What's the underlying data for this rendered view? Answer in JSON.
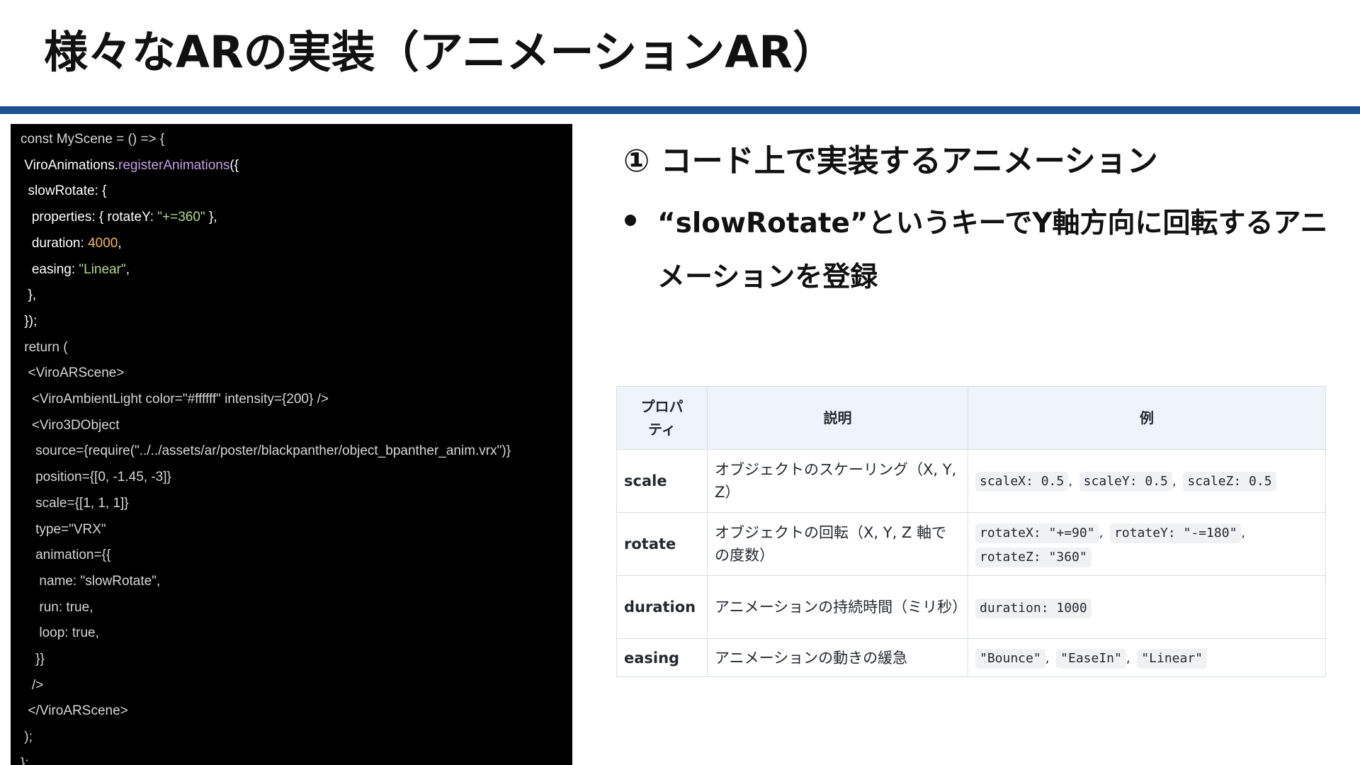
{
  "slide": {
    "title": "様々なARの実装（アニメーションAR）"
  },
  "code": {
    "lines": [
      [
        {
          "t": "const MyScene = () => {",
          "c": "plain"
        }
      ],
      [
        {
          "t": " ViroAnimations.",
          "c": "ident"
        },
        {
          "t": "registerAnimations",
          "c": "func"
        },
        {
          "t": "({",
          "c": "ident"
        }
      ],
      [
        {
          "t": "  slowRotate: {",
          "c": "ident"
        }
      ],
      [
        {
          "t": "   properties: { rotateY: ",
          "c": "ident"
        },
        {
          "t": "\"+=360\"",
          "c": "string"
        },
        {
          "t": " },",
          "c": "ident"
        }
      ],
      [
        {
          "t": "   duration: ",
          "c": "ident"
        },
        {
          "t": "4000",
          "c": "number"
        },
        {
          "t": ",",
          "c": "ident"
        }
      ],
      [
        {
          "t": "   easing: ",
          "c": "ident"
        },
        {
          "t": "\"Linear\"",
          "c": "string"
        },
        {
          "t": ",",
          "c": "ident"
        }
      ],
      [
        {
          "t": "  },",
          "c": "ident"
        }
      ],
      [
        {
          "t": " });",
          "c": "ident"
        }
      ],
      [
        {
          "t": " return (",
          "c": "plain"
        }
      ],
      [
        {
          "t": "  <ViroARScene>",
          "c": "plain"
        }
      ],
      [
        {
          "t": "   <ViroAmbientLight color=\"#ffffff\" intensity={200} />",
          "c": "plain"
        }
      ],
      [
        {
          "t": "   <Viro3DObject",
          "c": "plain"
        }
      ],
      [
        {
          "t": "    source={require(\"../../assets/ar/poster/blackpanther/object_bpanther_anim.vrx\")}",
          "c": "plain"
        }
      ],
      [
        {
          "t": "    position={[0, -1.45, -3]}",
          "c": "plain"
        }
      ],
      [
        {
          "t": "    scale={[1, 1, 1]}",
          "c": "plain"
        }
      ],
      [
        {
          "t": "    type=\"VRX\"",
          "c": "plain"
        }
      ],
      [
        {
          "t": "    animation={{",
          "c": "plain"
        }
      ],
      [
        {
          "t": "     name: \"slowRotate\",",
          "c": "plain"
        }
      ],
      [
        {
          "t": "     run: true,",
          "c": "plain"
        }
      ],
      [
        {
          "t": "     loop: true,",
          "c": "plain"
        }
      ],
      [
        {
          "t": "    }}",
          "c": "plain"
        }
      ],
      [
        {
          "t": "   />",
          "c": "plain"
        }
      ],
      [
        {
          "t": "  </ViroARScene>",
          "c": "plain"
        }
      ],
      [
        {
          "t": " );",
          "c": "plain"
        }
      ],
      [
        {
          "t": "};",
          "c": "plain"
        }
      ]
    ]
  },
  "right": {
    "heading": "① コード上で実装するアニメーション",
    "bullet_line1": "“slowRotate”というキーでY軸方向に回転するアニ",
    "bullet_line2": "メーションを登録"
  },
  "table": {
    "headers": [
      "プロパ\nティ",
      "説明",
      "例"
    ],
    "rows": [
      {
        "name": "scale",
        "desc": "オブジェクトのスケーリング（X, Y, Z）",
        "examples": [
          "scaleX: 0.5",
          "scaleY: 0.5",
          "scaleZ: 0.5"
        ]
      },
      {
        "name": "rotate",
        "desc": "オブジェクトの回転（X, Y, Z 軸での度数）",
        "examples": [
          "rotateX: \"+=90\"",
          "rotateY: \"-=180\"",
          "rotateZ: \"360\""
        ]
      },
      {
        "name": "duration",
        "desc": "アニメーションの持続時間（ミリ秒）",
        "examples": [
          "duration: 1000"
        ]
      },
      {
        "name": "easing",
        "desc": "アニメーションの動きの緩急",
        "examples": [
          "\"Bounce\"",
          "\"EaseIn\"",
          "\"Linear\""
        ]
      }
    ]
  },
  "colors": {
    "accent_rule": "#1e5391",
    "code_bg": "#000000",
    "code_function": "#c79ee6",
    "code_string": "#b5d98c",
    "code_number": "#f2b75a",
    "table_header_bg": "#eef4fa"
  }
}
